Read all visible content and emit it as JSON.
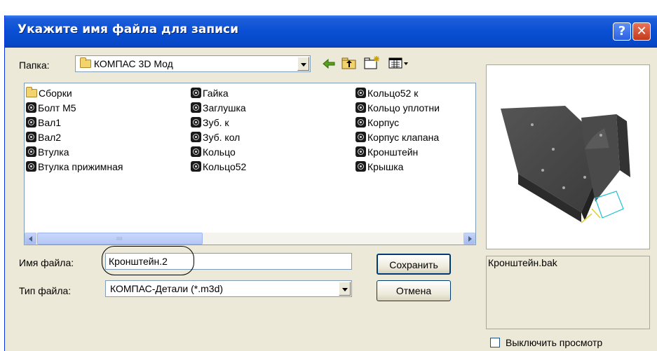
{
  "dialog": {
    "title": "Укажите имя файла для записи",
    "help_button": "?",
    "close_button": "✕"
  },
  "folder": {
    "label": "Папка:",
    "value": "КОМПАС 3D Мод"
  },
  "toolbar_icons": [
    "back-arrow-icon",
    "up-folder-icon",
    "new-folder-icon",
    "view-menu-icon"
  ],
  "files": {
    "columns": [
      [
        {
          "name": "Сборки",
          "icon": "folder-icon"
        },
        {
          "name": "Болт М5",
          "icon": "part-icon"
        },
        {
          "name": "Вал1",
          "icon": "part-icon"
        },
        {
          "name": "Вал2",
          "icon": "part-icon"
        },
        {
          "name": "Втулка",
          "icon": "part-icon"
        },
        {
          "name": "Втулка прижимная",
          "icon": "part-icon"
        }
      ],
      [
        {
          "name": "Гайка",
          "icon": "part-icon"
        },
        {
          "name": "Заглушка",
          "icon": "part-icon"
        },
        {
          "name": "Зуб. к",
          "icon": "part-icon"
        },
        {
          "name": "Зуб. кол",
          "icon": "part-icon"
        },
        {
          "name": "Кольцо",
          "icon": "part-icon"
        },
        {
          "name": "Кольцо52",
          "icon": "part-icon"
        }
      ],
      [
        {
          "name": "Кольцо52 к",
          "icon": "part-icon"
        },
        {
          "name": "Кольцо уплотни",
          "icon": "part-icon"
        },
        {
          "name": "Корпус",
          "icon": "part-icon"
        },
        {
          "name": "Корпус клапана",
          "icon": "part-icon"
        },
        {
          "name": "Кронштейн",
          "icon": "part-icon"
        },
        {
          "name": "Крышка",
          "icon": "part-icon"
        }
      ]
    ],
    "scroll_grip": "IIII"
  },
  "filename": {
    "label": "Имя файла:",
    "value": "Кронштейн.2"
  },
  "filetype": {
    "label": "Тип файла:",
    "value": "КОМПАС-Детали (*.m3d)"
  },
  "buttons": {
    "save": "Сохранить",
    "cancel": "Отмена"
  },
  "preview": {
    "info_text": "Кронштейн.bak",
    "disable_label": "Выключить просмотр",
    "disable_checked": false
  }
}
